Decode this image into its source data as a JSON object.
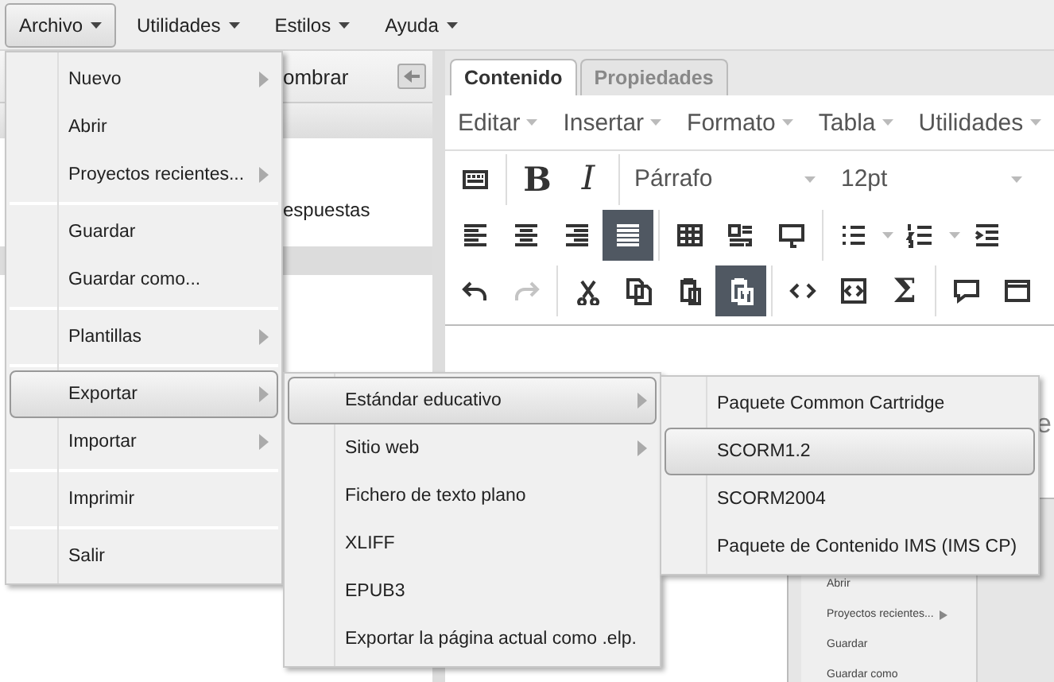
{
  "menubar": [
    {
      "label": "Archivo",
      "selected": true
    },
    {
      "label": "Utilidades",
      "selected": false
    },
    {
      "label": "Estilos",
      "selected": false
    },
    {
      "label": "Ayuda",
      "selected": false
    }
  ],
  "left_panel": {
    "header": "ombrar",
    "rows": [
      {
        "label": "espuestas",
        "selected": false
      },
      {
        "selected": true
      }
    ]
  },
  "tabs": [
    {
      "label": "Contenido",
      "selected": true
    },
    {
      "label": "Propiedades",
      "selected": false
    }
  ],
  "editor_menu": [
    "Editar",
    "Insertar",
    "Formato",
    "Tabla",
    "Utilidades"
  ],
  "toolbar": [
    [
      {
        "kind": "keyboard",
        "selected": false,
        "disabled": false
      },
      {
        "kind": "separator"
      },
      {
        "kind": "bold",
        "label": "B",
        "selected": false,
        "disabled": false
      },
      {
        "kind": "italic",
        "label": "I",
        "selected": false,
        "disabled": false
      },
      {
        "kind": "separator"
      },
      {
        "kind": "dropdown",
        "label": "Párrafo"
      },
      {
        "kind": "dropdown",
        "label": "12pt"
      }
    ],
    [
      {
        "kind": "align-left",
        "selected": false,
        "disabled": false
      },
      {
        "kind": "align-center",
        "selected": false,
        "disabled": false
      },
      {
        "kind": "align-right",
        "selected": false,
        "disabled": false
      },
      {
        "kind": "justify",
        "selected": true,
        "disabled": false
      },
      {
        "kind": "separator"
      },
      {
        "kind": "table",
        "selected": false,
        "disabled": false
      },
      {
        "kind": "image-text",
        "selected": false,
        "disabled": false
      },
      {
        "kind": "tooltip",
        "selected": false,
        "disabled": false
      },
      {
        "kind": "separator"
      },
      {
        "kind": "bullets",
        "selected": false,
        "disabled": false
      },
      {
        "kind": "caret"
      },
      {
        "kind": "numbers",
        "selected": false,
        "disabled": false
      },
      {
        "kind": "caret"
      },
      {
        "kind": "indent",
        "selected": false,
        "disabled": false
      }
    ],
    [
      {
        "kind": "undo",
        "selected": false,
        "disabled": false
      },
      {
        "kind": "redo",
        "selected": false,
        "disabled": true
      },
      {
        "kind": "separator"
      },
      {
        "kind": "cut",
        "selected": false,
        "disabled": false
      },
      {
        "kind": "copy",
        "selected": false,
        "disabled": false
      },
      {
        "kind": "paste",
        "selected": false,
        "disabled": false
      },
      {
        "kind": "paste-text",
        "selected": true,
        "disabled": false
      },
      {
        "kind": "separator"
      },
      {
        "kind": "code",
        "selected": false,
        "disabled": false
      },
      {
        "kind": "code-block",
        "selected": false,
        "disabled": false
      },
      {
        "kind": "sigma",
        "label": "Σ",
        "selected": false,
        "disabled": false
      },
      {
        "kind": "separator"
      },
      {
        "kind": "comment",
        "selected": false,
        "disabled": false
      },
      {
        "kind": "frame",
        "selected": false,
        "disabled": false
      }
    ]
  ],
  "content": {
    "heading": "e",
    "screenshot": {
      "items": [
        {
          "label": "Abrir",
          "submenu": false
        },
        {
          "label": "Proyectos recientes...",
          "submenu": true
        },
        {
          "label": "Guardar",
          "submenu": false
        },
        {
          "label": "Guardar como",
          "submenu": false
        }
      ]
    }
  },
  "menus": [
    {
      "items": [
        {
          "kind": "item",
          "label": "Nuevo",
          "submenu": true,
          "selected": false
        },
        {
          "kind": "item",
          "label": "Abrir",
          "submenu": false,
          "selected": false
        },
        {
          "kind": "item",
          "label": "Proyectos recientes...",
          "submenu": true,
          "selected": false
        },
        {
          "kind": "separator"
        },
        {
          "kind": "item",
          "label": "Guardar",
          "submenu": false,
          "selected": false
        },
        {
          "kind": "item",
          "label": "Guardar como...",
          "submenu": false,
          "selected": false
        },
        {
          "kind": "separator"
        },
        {
          "kind": "item",
          "label": "Plantillas",
          "submenu": true,
          "selected": false
        },
        {
          "kind": "separator"
        },
        {
          "kind": "item",
          "label": "Exportar",
          "submenu": true,
          "selected": true
        },
        {
          "kind": "item",
          "label": "Importar",
          "submenu": true,
          "selected": false
        },
        {
          "kind": "separator"
        },
        {
          "kind": "item",
          "label": "Imprimir",
          "submenu": false,
          "selected": false
        },
        {
          "kind": "separator"
        },
        {
          "kind": "item",
          "label": "Salir",
          "submenu": false,
          "selected": false
        }
      ]
    },
    {
      "items": [
        {
          "kind": "item",
          "label": "Estándar educativo",
          "submenu": true,
          "selected": true
        },
        {
          "kind": "item",
          "label": "Sitio web",
          "submenu": true,
          "selected": false
        },
        {
          "kind": "item",
          "label": "Fichero de texto plano",
          "submenu": false,
          "selected": false
        },
        {
          "kind": "item",
          "label": "XLIFF",
          "submenu": false,
          "selected": false
        },
        {
          "kind": "item",
          "label": "EPUB3",
          "submenu": false,
          "selected": false
        },
        {
          "kind": "item",
          "label": "Exportar la página actual como .elp.",
          "submenu": false,
          "selected": false
        }
      ]
    },
    {
      "items": [
        {
          "kind": "item",
          "label": "Paquete Common Cartridge",
          "submenu": false,
          "selected": false
        },
        {
          "kind": "item",
          "label": "SCORM1.2",
          "submenu": false,
          "selected": true
        },
        {
          "kind": "item",
          "label": "SCORM2004",
          "submenu": false,
          "selected": false
        },
        {
          "kind": "item",
          "label": "Paquete de Contenido IMS (IMS CP)",
          "submenu": false,
          "selected": false
        }
      ]
    }
  ]
}
